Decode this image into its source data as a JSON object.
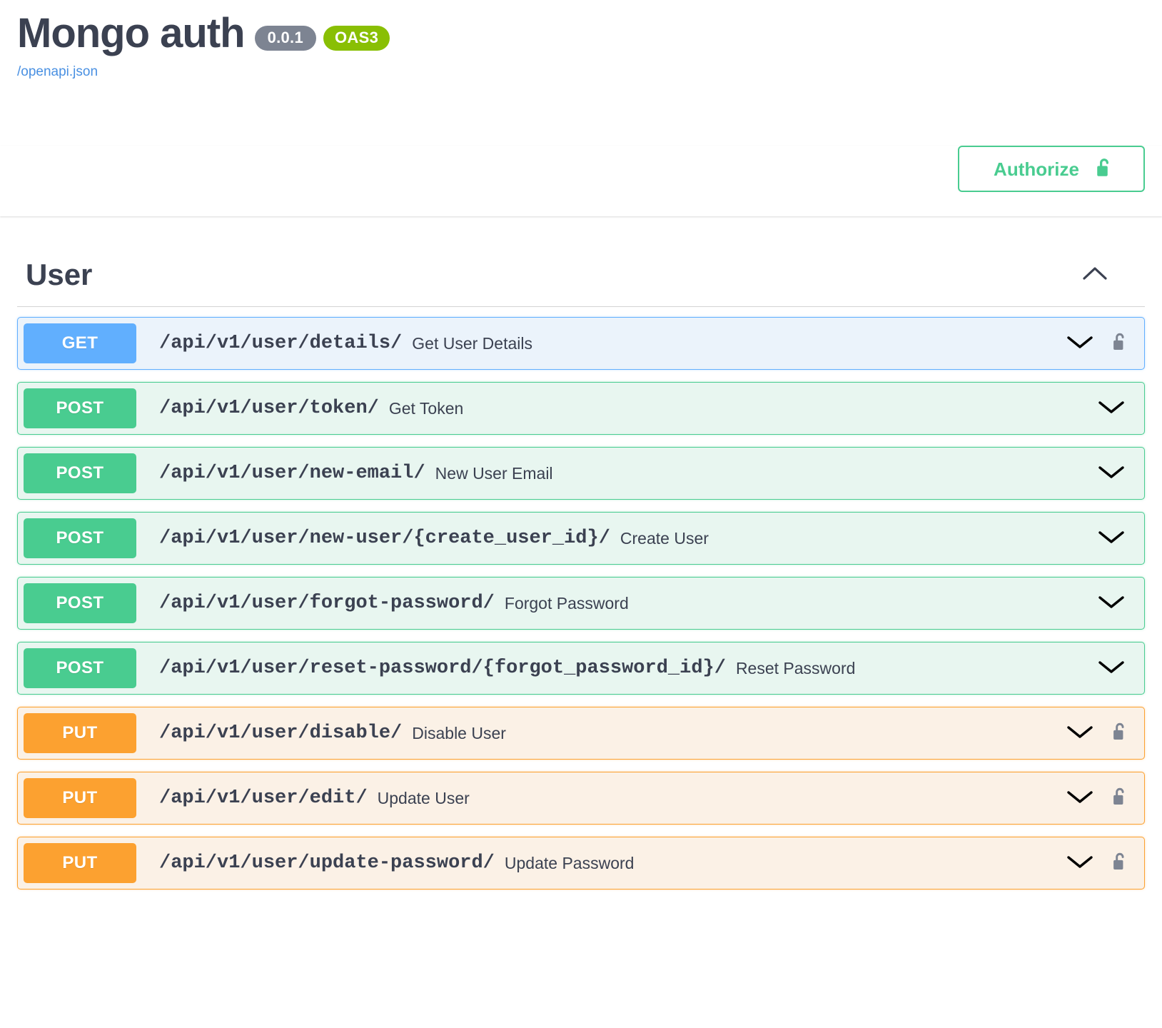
{
  "header": {
    "title": "Mongo auth",
    "version_badge": "0.0.1",
    "oas_badge": "OAS3",
    "spec_link": "/openapi.json"
  },
  "auth": {
    "authorize_label": "Authorize",
    "lock_icon": "lock-open-icon"
  },
  "colors": {
    "get": "#61affe",
    "post": "#49cc90",
    "put": "#fca130",
    "get_bg": "#ebf3fb",
    "post_bg": "#e8f6f0",
    "put_bg": "#fbf1e6",
    "oas_badge": "#89bf04",
    "version_badge": "#7d8492",
    "link": "#4990e2",
    "text": "#3b4151",
    "lock_gray": "#7d8492"
  },
  "tag": {
    "name": "User",
    "collapse_icon": "chevron-up-icon"
  },
  "operations": [
    {
      "method": "GET",
      "method_class": "get",
      "path": "/api/v1/user/details/",
      "summary": "Get User Details",
      "locked": true,
      "expand_icon": "chevron-down-icon"
    },
    {
      "method": "POST",
      "method_class": "post",
      "path": "/api/v1/user/token/",
      "summary": "Get Token",
      "locked": false,
      "expand_icon": "chevron-down-icon"
    },
    {
      "method": "POST",
      "method_class": "post",
      "path": "/api/v1/user/new-email/",
      "summary": "New User Email",
      "locked": false,
      "expand_icon": "chevron-down-icon"
    },
    {
      "method": "POST",
      "method_class": "post",
      "path": "/api/v1/user/new-user/{create_user_id}/",
      "summary": "Create User",
      "locked": false,
      "expand_icon": "chevron-down-icon"
    },
    {
      "method": "POST",
      "method_class": "post",
      "path": "/api/v1/user/forgot-password/",
      "summary": "Forgot Password",
      "locked": false,
      "expand_icon": "chevron-down-icon"
    },
    {
      "method": "POST",
      "method_class": "post",
      "path": "/api/v1/user/reset-password/{forgot_password_id}/",
      "summary": "Reset Password",
      "locked": false,
      "expand_icon": "chevron-down-icon"
    },
    {
      "method": "PUT",
      "method_class": "put",
      "path": "/api/v1/user/disable/",
      "summary": "Disable User",
      "locked": true,
      "expand_icon": "chevron-down-icon"
    },
    {
      "method": "PUT",
      "method_class": "put",
      "path": "/api/v1/user/edit/",
      "summary": "Update User",
      "locked": true,
      "expand_icon": "chevron-down-icon"
    },
    {
      "method": "PUT",
      "method_class": "put",
      "path": "/api/v1/user/update-password/",
      "summary": "Update Password",
      "locked": true,
      "expand_icon": "chevron-down-icon"
    }
  ]
}
